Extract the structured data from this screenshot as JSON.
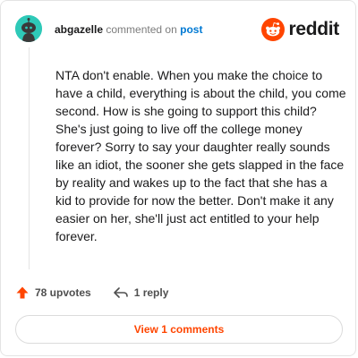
{
  "header": {
    "username": "abgazelle",
    "action_text": "commented on",
    "target_link": "post",
    "brand": "reddit"
  },
  "comment": {
    "body": "NTA don't enable. When you make the choice to have a child, everything is about the child, you come second. How is she going to support this child? She's just going to live off the college money forever? Sorry to say your daughter really sounds like an idiot, the sooner she gets slapped in the face by reality and wakes up to the fact that she has a kid to provide for now the better. Don't make it any easier on her, she'll just act entitled to your help forever."
  },
  "actions": {
    "upvotes_label": "78 upvotes",
    "replies_label": "1 reply"
  },
  "view_comments_label": "View 1 comments",
  "colors": {
    "brand_orange": "#ff4500",
    "avatar_bg": "#2ec9b8",
    "link_blue": "#0079d3"
  },
  "icons": {
    "avatar": "snoo-avatar-icon",
    "logo": "reddit-logo-icon",
    "upvote": "upvote-arrow-icon",
    "reply": "reply-arrow-icon"
  }
}
